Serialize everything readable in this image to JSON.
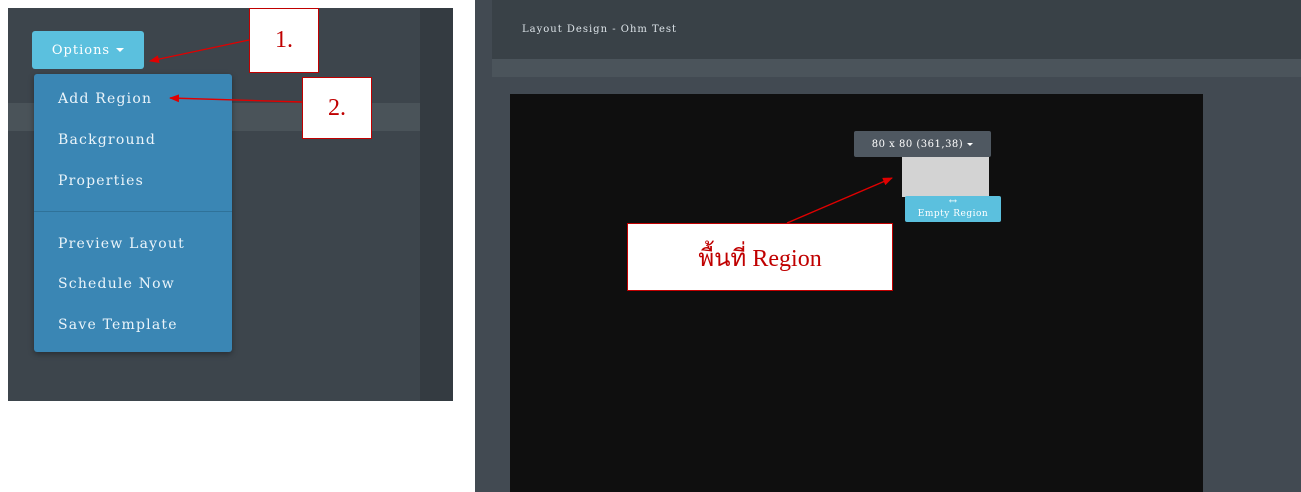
{
  "options_menu": {
    "button_label": "Options",
    "items": [
      "Add Region",
      "Background",
      "Properties",
      "Preview Layout",
      "Schedule Now",
      "Save Template"
    ]
  },
  "designer": {
    "header_title": "Layout Design - Ohm Test",
    "region_size_label": "80 x 80 (361,38)",
    "region_tag_arrows": "↔",
    "region_tag_label": "Empty Region"
  },
  "annotations": {
    "step1": "1.",
    "step2": "2.",
    "region_note": "พื้นที่ Region"
  },
  "colors": {
    "accent": "#5bc0de",
    "dropdown": "#3a86b4",
    "annotation": "#c00000",
    "canvas": "#0f0f0f"
  }
}
